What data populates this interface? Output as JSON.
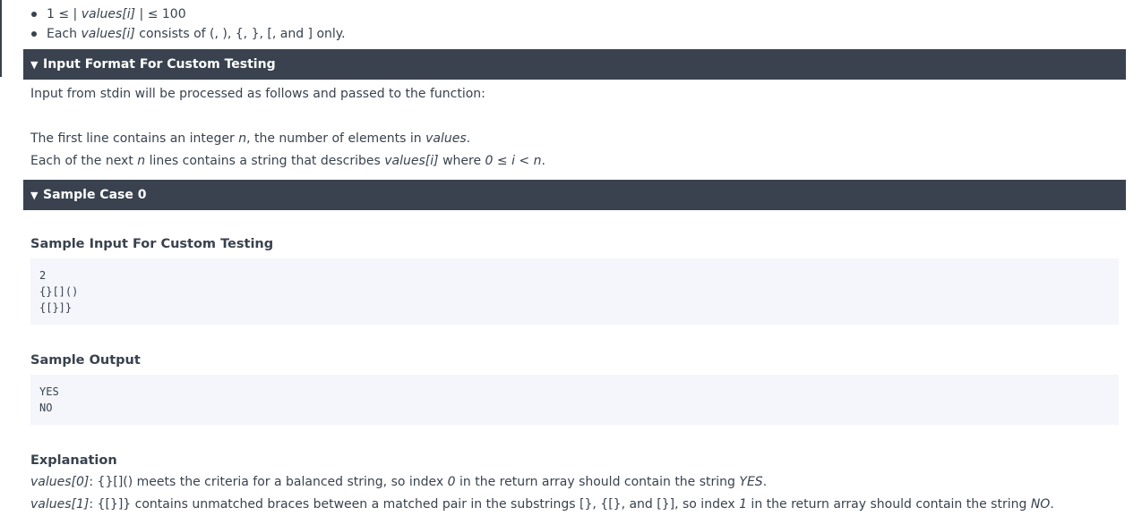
{
  "constraints": {
    "item1": {
      "prefix": "1 ≤ | ",
      "var": "values[i]",
      "suffix": " | ≤ 100"
    },
    "item2": {
      "prefix": "Each ",
      "var": "values[i]",
      "suffix": " consists of (, ), {, }, [, and ] only."
    }
  },
  "input_format": {
    "header": "Input Format For Custom Testing",
    "intro": "Input from stdin will be processed as follows and passed to the function:",
    "line1": {
      "a": "The first line contains an integer ",
      "n": "n",
      "b": ", the number of elements in ",
      "values": "values",
      "c": "."
    },
    "line2": {
      "a": "Each of the next ",
      "n": "n",
      "b": " lines contains a string that describes ",
      "var": "values[i]",
      "c": " where ",
      "cond": "0 ≤ i < n",
      "d": "."
    }
  },
  "sample_case": {
    "header": "Sample Case 0",
    "input_title": "Sample Input For Custom Testing",
    "input_lines": [
      "2",
      "{}[]()",
      "{[}]}"
    ],
    "output_title": "Sample Output",
    "output_lines": [
      "YES",
      "NO"
    ],
    "explanation_title": "Explanation",
    "explanation1": {
      "var": "values[0]",
      "a": ": {}[]() meets the criteria for a balanced string, so index ",
      "idx": "0",
      "b": " in the return array should contain the string ",
      "ans": "YES",
      "c": "."
    },
    "explanation2": {
      "var": "values[1]",
      "a": ": {[}]} contains unmatched braces between a matched pair in the substrings [}, {[}, and [}], so index ",
      "idx": "1",
      "b": " in the return array should contain the string ",
      "ans": "NO",
      "c": "."
    }
  },
  "colors": {
    "header_bg": "#39424e",
    "text": "#39424e",
    "code_bg": "#f4f6fb"
  }
}
